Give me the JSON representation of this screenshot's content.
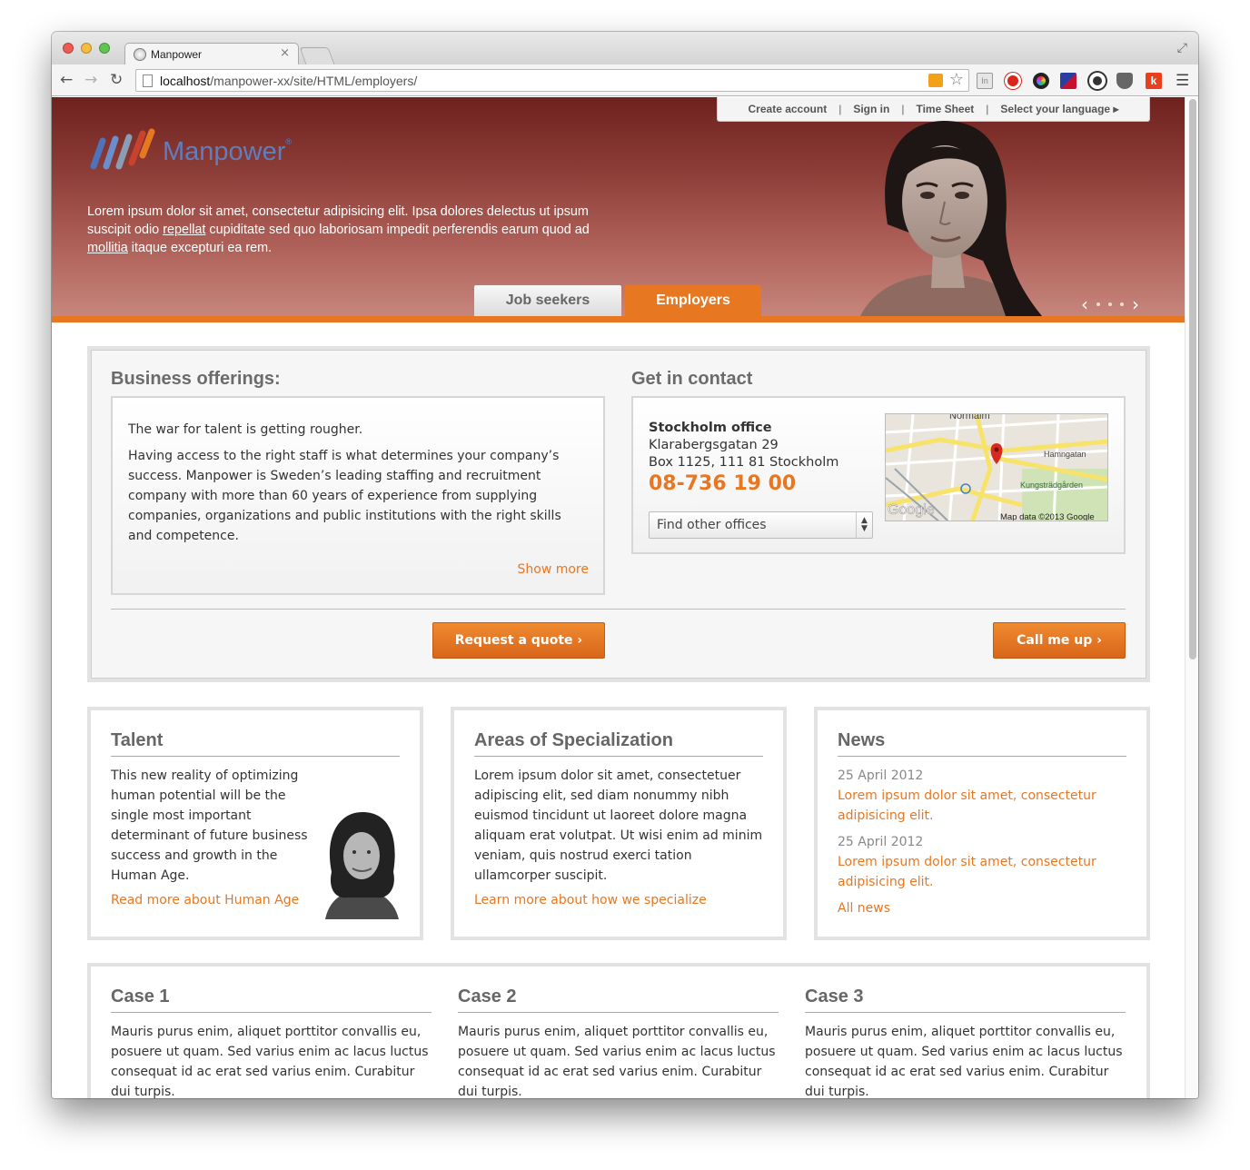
{
  "browser": {
    "tab_title": "Manpower",
    "tab_close": "×",
    "url_host": "localhost",
    "url_path": "/manpower-xx/site/HTML/employers/",
    "ext_in_label": "In",
    "ext_k_label": "k"
  },
  "utility_nav": {
    "create_account": "Create account",
    "sign_in": "Sign in",
    "time_sheet": "Time Sheet",
    "select_language": "Select your language ▸",
    "separator": "|"
  },
  "brand": {
    "name": "Manpower",
    "reg": "®"
  },
  "hero": {
    "text_1": "Lorem ipsum dolor sit amet, consectetur adipisicing elit. Ipsa dolores delectus ut ipsum suscipit odio ",
    "link_1": "repellat",
    "text_2": " cupiditate sed quo laboriosam impedit perferendis earum quod ad ",
    "link_2": "mollitia",
    "text_3": " itaque excepturi ea rem."
  },
  "main_tabs": {
    "job_seekers": "Job seekers",
    "employers": "Employers"
  },
  "offerings": {
    "heading": "Business offerings:",
    "lead": "The war for talent is getting rougher.",
    "body": "Having access to the right staff is what determines your company’s success. Manpower is Sweden’s leading staffing and recruitment company with more than 60 years of experience from supplying companies, organizations and public institutions with the right skills and competence.",
    "show_more": "Show more",
    "request_quote": "Request a quote ›"
  },
  "contact": {
    "heading": "Get in contact",
    "office_name": "Stockholm office",
    "address_1": "Klarabergsgatan 29",
    "address_2": "Box 1125, 111 81 Stockholm",
    "phone": "08-736 19 00",
    "select_value": "Find other offices",
    "call_me": "Call me up ›",
    "map_labels": {
      "top": "Normalm",
      "street": "Hamngatan",
      "park": "Kungsträdgården",
      "logo": "Google",
      "attribution": "Map data ©2013 Google"
    }
  },
  "talent": {
    "title": "Talent",
    "body": "This new reality of optimizing human potential will be the single most important determinant of future business success and growth in the Human Age.",
    "link": "Read more about Human Age"
  },
  "specialization": {
    "title": "Areas of Specialization",
    "body": "Lorem ipsum dolor sit amet, consectetuer adipiscing elit, sed diam nonummy nibh euismod tincidunt ut laoreet dolore magna aliquam erat volutpat. Ut wisi enim ad minim veniam, quis nostrud exerci tation ullamcorper suscipit.",
    "link": "Learn more about how we specialize"
  },
  "news": {
    "title": "News",
    "items": [
      {
        "date": "25 April 2012",
        "headline": "Lorem ipsum dolor sit amet, consectetur adipisicing elit."
      },
      {
        "date": "25 April 2012",
        "headline": "Lorem ipsum dolor sit amet, consectetur adipisicing elit."
      }
    ],
    "all_link": "All news"
  },
  "cases": [
    {
      "title": "Case 1",
      "body": "Mauris purus enim, aliquet porttitor convallis eu, posuere ut quam. Sed varius enim ac lacus luctus consequat id ac erat sed varius enim. Curabitur dui turpis."
    },
    {
      "title": "Case 2",
      "body": "Mauris purus enim, aliquet porttitor convallis eu, posuere ut quam. Sed varius enim ac lacus luctus consequat id ac erat sed varius enim. Curabitur dui turpis."
    },
    {
      "title": "Case 3",
      "body": "Mauris purus enim, aliquet porttitor convallis eu, posuere ut quam. Sed varius enim ac lacus luctus consequat id ac erat sed varius enim. Curabitur dui turpis."
    }
  ],
  "colors": {
    "accent": "#e87722",
    "hero_top": "#6e211e",
    "hero_bottom": "#c6867c",
    "logo_blue": "#5e7fbf"
  },
  "icons": [
    "back-arrow-icon",
    "forward-arrow-icon",
    "reload-icon",
    "page-icon",
    "rss-icon",
    "star-icon",
    "menu-icon",
    "map-pin-icon",
    "chevron-left-icon",
    "chevron-right-icon"
  ]
}
